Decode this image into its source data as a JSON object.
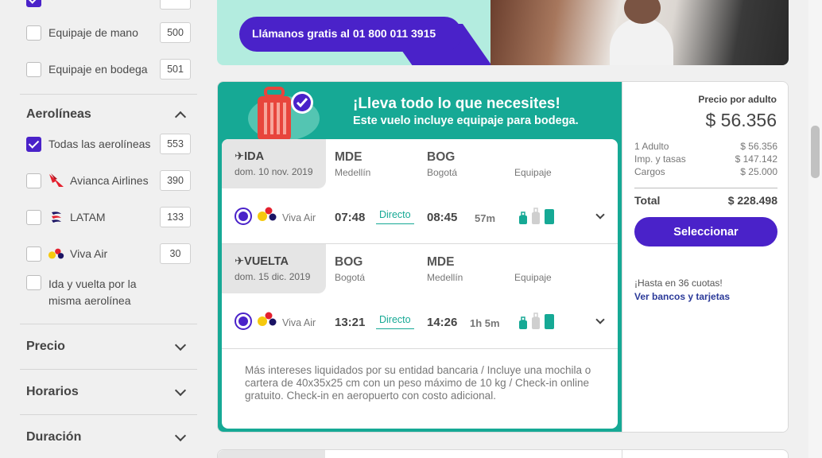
{
  "sidebar": {
    "baggage": [
      {
        "label": "Equipaje de mano",
        "count": "500",
        "checked": false
      },
      {
        "label": "Equipaje en bodega",
        "count": "501",
        "checked": false
      }
    ],
    "airlines_title": "Aerolíneas",
    "airlines": [
      {
        "label": "Todas las aerolíneas",
        "count": "553",
        "checked": true
      },
      {
        "label": "Avianca Airlines",
        "count": "390",
        "checked": false
      },
      {
        "label": "LATAM",
        "count": "133",
        "checked": false
      },
      {
        "label": "Viva Air",
        "count": "30",
        "checked": false
      }
    ],
    "same_airline_label": "Ida y vuelta por la misma aerolínea",
    "sections": [
      "Precio",
      "Horarios",
      "Duración"
    ]
  },
  "banner": {
    "text": "Llámanos gratis al 01 800 011 3915"
  },
  "card": {
    "promo_title": "¡Lleva todo lo que necesites!",
    "promo_subtitle": "Este vuelo incluye equipaje para bodega.",
    "legs": [
      {
        "title": "✈IDA",
        "date": "dom. 10 nov. 2019",
        "origin_code": "MDE",
        "origin_city": "Medellín",
        "dest_code": "BOG",
        "dest_city": "Bogotá",
        "baggage_label": "Equipaje",
        "airline": "Viva Air",
        "depart": "07:48",
        "stops": "Directo",
        "arrive": "08:45",
        "duration": "57m"
      },
      {
        "title": "✈VUELTA",
        "date": "dom. 15 dic. 2019",
        "origin_code": "BOG",
        "origin_city": "Bogotá",
        "dest_code": "MDE",
        "dest_city": "Medellín",
        "baggage_label": "Equipaje",
        "airline": "Viva Air",
        "depart": "13:21",
        "stops": "Directo",
        "arrive": "14:26",
        "duration": "1h 5m"
      }
    ],
    "note": "Más intereses liquidados por su entidad bancaria / Incluye una mochila o cartera de 40x35x25 cm con un peso máximo de 10 kg / Check-in online gratuito. Check-in en aeropuerto con costo adicional."
  },
  "price": {
    "label": "Precio por adulto",
    "amount": "$ 56.356",
    "lines": [
      {
        "label": "1 Adulto",
        "value": "$ 56.356"
      },
      {
        "label": "Imp. y tasas",
        "value": "$ 147.142"
      },
      {
        "label": "Cargos",
        "value": "$ 25.000"
      }
    ],
    "total_label": "Total",
    "total_value": "$ 228.498",
    "button": "Seleccionar",
    "installments": "¡Hasta en 36 cuotas!",
    "banks_link": "Ver bancos y tarjetas"
  },
  "colors": {
    "primary": "#4a22c9",
    "green": "#16a995",
    "banner_bg": "#b3ecdf"
  }
}
